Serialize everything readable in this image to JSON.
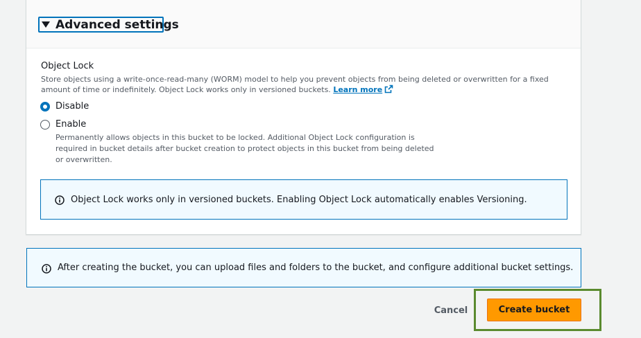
{
  "advanced_settings": {
    "title": "Advanced settings",
    "expanded": true
  },
  "object_lock": {
    "label": "Object Lock",
    "description": "Store objects using a write-once-read-many (WORM) model to help you prevent objects from being deleted or overwritten for a fixed amount of time or indefinitely. Object Lock works only in versioned buckets.",
    "learn_more": "Learn more",
    "options": [
      {
        "label": "Disable",
        "selected": true
      },
      {
        "label": "Enable",
        "selected": false,
        "description": "Permanently allows objects in this bucket to be locked. Additional Object Lock configuration is required in bucket details after bucket creation to protect objects in this bucket from being deleted or overwritten."
      }
    ],
    "info_alert": "Object Lock works only in versioned buckets. Enabling Object Lock automatically enables Versioning."
  },
  "bucket_info_alert": "After creating the bucket, you can upload files and folders to the bucket, and configure additional bucket settings.",
  "actions": {
    "cancel_label": "Cancel",
    "create_label": "Create bucket"
  },
  "colors": {
    "accent": "#0073bb",
    "primary_button": "#ff9900",
    "highlight": "#5a8a2e"
  },
  "icons": [
    "caret-down-icon",
    "external-link-icon",
    "info-icon"
  ]
}
